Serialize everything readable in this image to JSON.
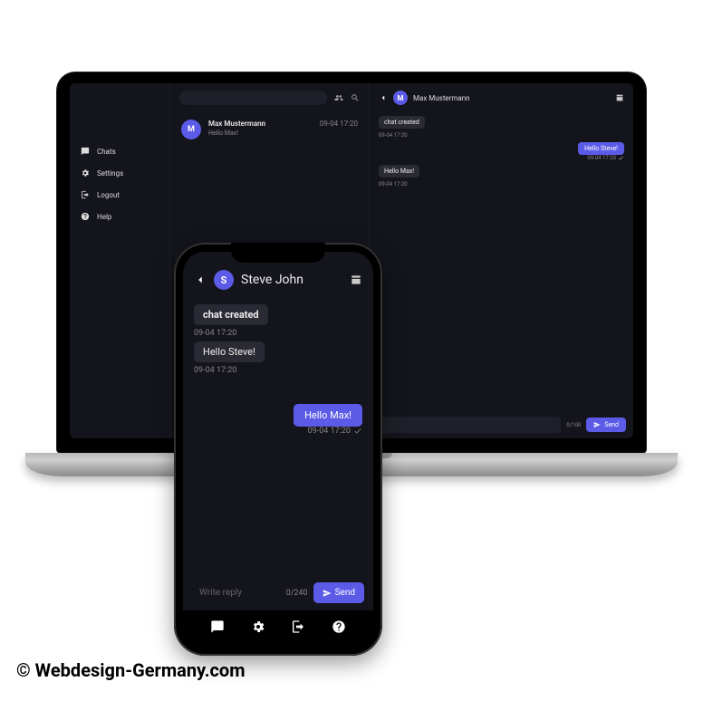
{
  "laptop": {
    "sidebar": {
      "items": [
        {
          "label": "Chats"
        },
        {
          "label": "Settings"
        },
        {
          "label": "Logout"
        },
        {
          "label": "Help"
        }
      ]
    },
    "list": {
      "items": [
        {
          "avatar": "M",
          "name": "Max Mustermann",
          "time": "09-04 17:20",
          "preview": "Hello Max!"
        }
      ]
    },
    "chat": {
      "avatar": "M",
      "title": "Max Mustermann",
      "messages": [
        {
          "type": "chip",
          "text": "chat created",
          "ts": "09-04 17:20"
        },
        {
          "type": "out",
          "text": "Hello Steve!",
          "ts": "09-04 17:20"
        },
        {
          "type": "chip2",
          "text": "Hello Max!",
          "ts": "09-04 17:20"
        }
      ],
      "counter": "0/100",
      "send": "Send"
    }
  },
  "phone": {
    "avatar": "S",
    "title": "Steve John",
    "messages": [
      {
        "type": "chip",
        "text": "chat created",
        "ts": "09-04 17:20"
      },
      {
        "type": "chip2",
        "text": "Hello Steve!",
        "ts": "09-04 17:20"
      },
      {
        "type": "out",
        "text": "Hello Max!",
        "ts": "09-04 17:20"
      }
    ],
    "reply_placeholder": "Write reply",
    "counter": "0/240",
    "send": "Send"
  },
  "copyright": "© Webdesign-Germany.com"
}
